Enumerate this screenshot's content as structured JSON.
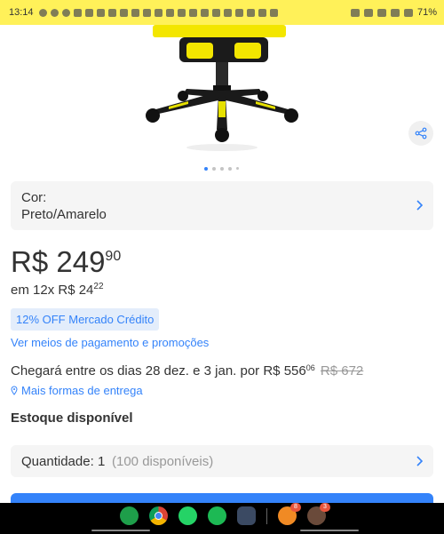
{
  "status_bar": {
    "time": "13:14",
    "battery": "71%"
  },
  "product": {
    "image_alt": "gaming-chair-photo",
    "carousel": {
      "total": 5,
      "active": 1
    }
  },
  "color_selector": {
    "label": "Cor:",
    "value": "Preto/Amarelo"
  },
  "price": {
    "currency": "R$",
    "integer": "249",
    "cents": "90"
  },
  "installments": {
    "text": "em 12x R$ 24",
    "cents": "22"
  },
  "discount_badge": "12% OFF Mercado Crédito",
  "payment_link": "Ver meios de pagamento e promoções",
  "delivery": {
    "text": "Chegará entre os dias 28 dez. e 3 jan. por R$ 556",
    "cents": "06",
    "old_price": "R$ 672",
    "more_link": "Mais formas de entrega"
  },
  "stock": "Estoque disponível",
  "quantity": {
    "label": "Quantidade:",
    "value": "1",
    "available": "(100 disponíveis)"
  },
  "taskbar": {
    "apps": [
      "phone-icon",
      "chrome-icon",
      "whatsapp-icon",
      "spotify-icon",
      "app-grid-icon"
    ],
    "recent_badges": [
      "8",
      "3"
    ]
  },
  "colors": {
    "brand_yellow": "#fff159",
    "link_blue": "#3483fa",
    "badge_bg": "#e3edfb"
  }
}
